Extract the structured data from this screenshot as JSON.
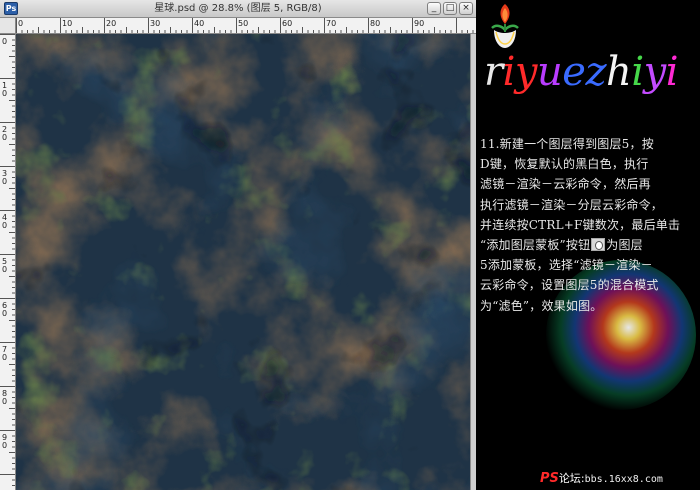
{
  "window": {
    "title": "星球.psd @ 28.8% (图层 5, RGB/8)",
    "app_icon": "Ps",
    "controls": [
      {
        "name": "minimize-icon",
        "glyph": "_"
      },
      {
        "name": "maximize-icon",
        "glyph": "□"
      },
      {
        "name": "close-icon",
        "glyph": "×"
      }
    ]
  },
  "ruler": {
    "h_labels": [
      "0",
      "10",
      "20",
      "30",
      "40",
      "50",
      "60",
      "70",
      "80",
      "90"
    ],
    "v_labels": [
      "0",
      "10",
      "20",
      "30",
      "40",
      "50",
      "60",
      "70",
      "80",
      "90"
    ]
  },
  "logo": {
    "letters": [
      {
        "ch": "r",
        "color": "#e8e8e8"
      },
      {
        "ch": "i",
        "color": "#ff2a2a"
      },
      {
        "ch": "y",
        "color": "#ff2a2a"
      },
      {
        "ch": "u",
        "color": "#b93cff"
      },
      {
        "ch": "e",
        "color": "#3a6bff"
      },
      {
        "ch": "z",
        "color": "#3a6bff"
      },
      {
        "ch": "h",
        "color": "#f5f5f5"
      },
      {
        "ch": "i",
        "color": "#46d84a"
      },
      {
        "ch": "y",
        "color": "#c34bff"
      },
      {
        "ch": "i",
        "color": "#ff2ad4"
      }
    ]
  },
  "instructions": {
    "line1": "11.新建一个图层得到图层5，按",
    "line2": "D键，恢复默认的黑白色，执行",
    "line3": "滤镜－渲染－云彩命令，然后再",
    "line4": "执行滤镜－渲染－分层云彩命令，",
    "line5": "并连续按CTRL+F键数次，最后单击",
    "line6_pre": "“添加图层蒙板”按钮",
    "line6_post": "为图层",
    "line7": "5添加蒙板，选择“滤镜－渲染－",
    "line8": "云彩命令，设置图层5的混合模式",
    "line9": "为“滤色”，效果如图。"
  },
  "footer": {
    "brand": "PS",
    "label": "论坛:",
    "site": "bbs.16xx8.com"
  },
  "colors": {
    "accent_red": "#ff2a2a",
    "panel_bg": "#000000",
    "chrome": "#d4d0c8"
  }
}
